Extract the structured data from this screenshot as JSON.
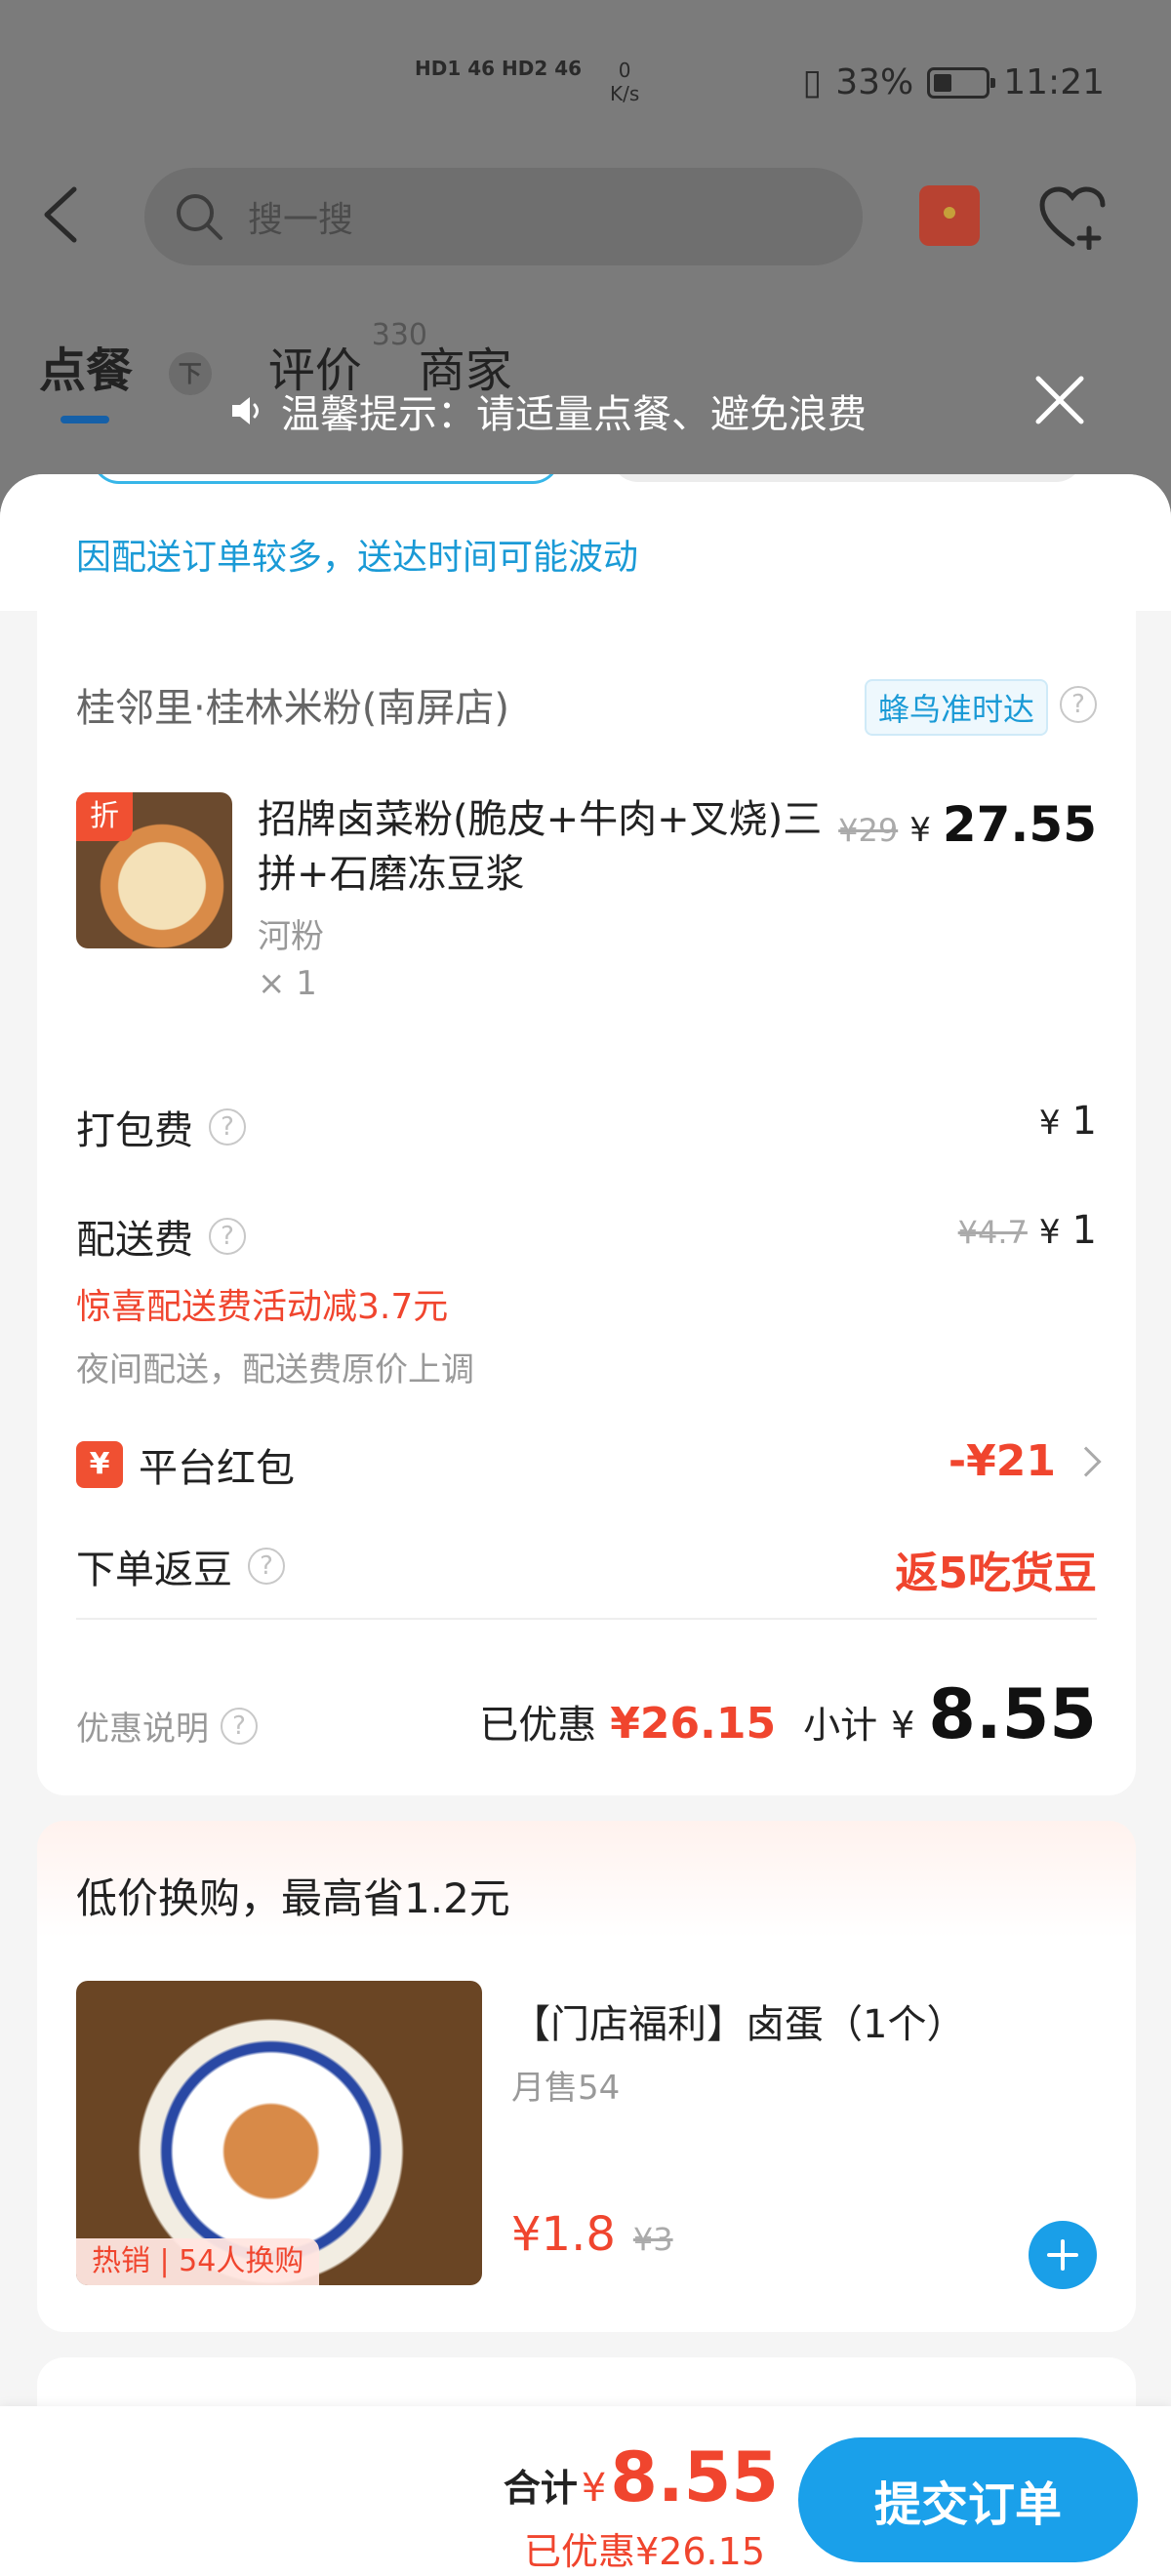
{
  "status_bar": {
    "signal_text": "HD1 46 HD2 46",
    "net_speed": "0",
    "net_unit": "K/s",
    "battery": "33%",
    "time": "11:21"
  },
  "header": {
    "search_placeholder": "搜一搜"
  },
  "tabs": [
    {
      "label": "点餐",
      "active": true
    },
    {
      "label": "评价",
      "badge": "330"
    },
    {
      "label": "商家"
    }
  ],
  "pin_glyph": "下",
  "tip": {
    "text": "温馨提示：请适量点餐、避免浪费"
  },
  "notice": "因配送订单较多，送达时间可能波动",
  "order": {
    "shop_name": "桂邻里·桂林米粉(南屏店)",
    "delivery_badge": "蜂鸟准时达",
    "item": {
      "tag": "折",
      "name": "招牌卤菜粉(脆皮+牛肉+叉烧)三拼+石磨冻豆浆",
      "spec": "河粉",
      "qty": "× 1",
      "original_price": "¥29",
      "yen": "¥",
      "price": "27.55"
    },
    "packing": {
      "label": "打包费",
      "yen": "¥",
      "value": "1"
    },
    "delivery": {
      "label": "配送费",
      "original": "¥4.7",
      "yen": "¥",
      "value": "1",
      "promo": "惊喜配送费活动减3.7元",
      "note": "夜间配送，配送费原价上调"
    },
    "red_packet": {
      "icon": "¥",
      "label": "平台红包",
      "value": "-¥21"
    },
    "beans": {
      "label": "下单返豆",
      "value": "返5吃货豆"
    },
    "summary": {
      "explain": "优惠说明",
      "saved_label": "已优惠",
      "saved_value": "¥26.15",
      "subtotal_label": "小计",
      "subtotal_yen": "¥",
      "subtotal_value": "8.55"
    }
  },
  "addon": {
    "title": "低价换购，最高省1.2元",
    "product_name": "【门店福利】卤蛋（1个）",
    "sales": "月售54",
    "hot_tag": "热销 | 54人换购",
    "price": "¥1.8",
    "original_price": "¥3"
  },
  "bottom_bar": {
    "total_label": "合计",
    "total_yen": "¥",
    "total_value": "8.55",
    "saved": "已优惠¥26.15",
    "submit_label": "提交订单"
  },
  "colors": {
    "accent_blue": "#1aa0ea",
    "price_red": "#f0452e",
    "overlay_gray": "#7b7b7b"
  }
}
